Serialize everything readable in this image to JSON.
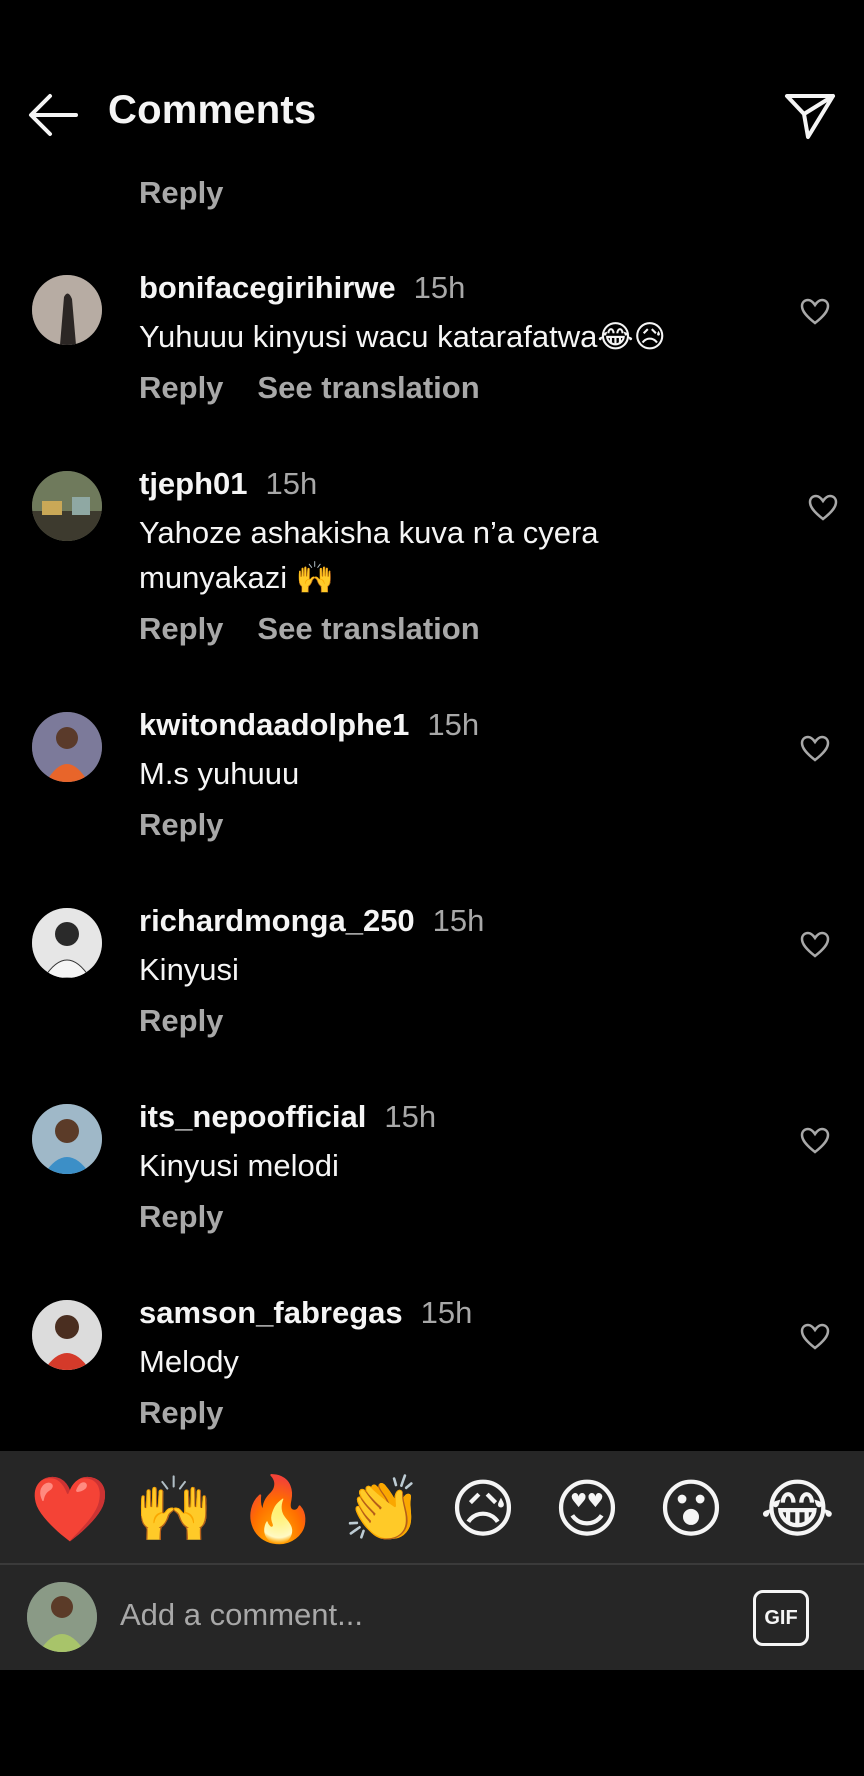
{
  "header": {
    "title": "Comments"
  },
  "top_reply": "Reply",
  "comments": [
    {
      "user": "bonifacegirihirwe",
      "time": "15h",
      "text": "Yuhuuu kinyusi wacu katarafatwa😂😥",
      "reply": "Reply",
      "translate": "See translation"
    },
    {
      "user": "tjeph01",
      "time": "15h",
      "text": "Yahoze ashakisha kuva n’a cyera munyakazi 🙌",
      "reply": "Reply",
      "translate": "See translation"
    },
    {
      "user": "kwitondaadolphe1",
      "time": "15h",
      "text": "M.s yuhuuu",
      "reply": "Reply"
    },
    {
      "user": "richardmonga_250",
      "time": "15h",
      "text": "Kinyusi",
      "reply": "Reply"
    },
    {
      "user": "its_nepoofficial",
      "time": "15h",
      "text": "Kinyusi melodi",
      "reply": "Reply"
    },
    {
      "user": "samson_fabregas",
      "time": "15h",
      "text": "Melody",
      "reply": "Reply"
    }
  ],
  "emoji_bar": [
    "❤️",
    "🙌",
    "🔥",
    "👏",
    "😥",
    "😍",
    "😮",
    "😂"
  ],
  "composer": {
    "placeholder": "Add a comment...",
    "gif_label": "GIF"
  },
  "colors": {
    "background": "#000000",
    "secondary_text": "#a8a8a8",
    "bar": "#262626"
  }
}
